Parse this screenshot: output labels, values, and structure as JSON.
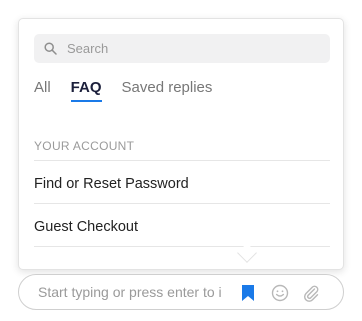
{
  "search": {
    "placeholder": "Search"
  },
  "tabs": [
    {
      "label": "All",
      "active": false
    },
    {
      "label": "FAQ",
      "active": true
    },
    {
      "label": "Saved replies",
      "active": false
    }
  ],
  "faq": {
    "section_label": "YOUR ACCOUNT",
    "items": [
      {
        "label": "Find or Reset Password"
      },
      {
        "label": "Guest Checkout"
      }
    ]
  },
  "composer": {
    "placeholder": "Start typing or press enter to i",
    "icons": [
      "bookmark-icon",
      "smiley-icon",
      "paperclip-icon"
    ]
  },
  "colors": {
    "accent": "#1a7ae8",
    "active_tab_text": "#1b1f3b",
    "muted": "#9a9a9a"
  }
}
